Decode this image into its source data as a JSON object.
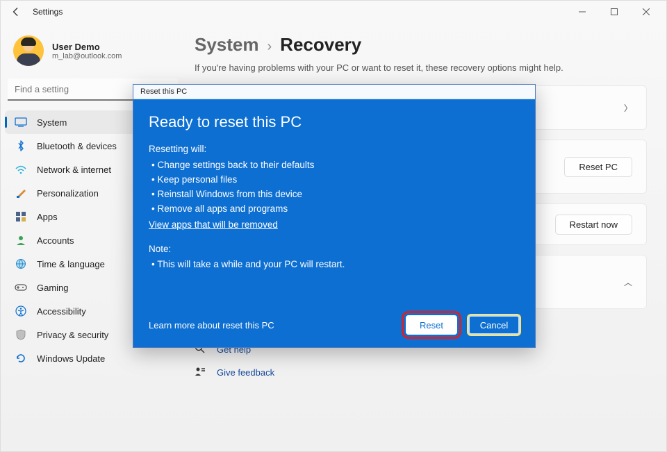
{
  "window": {
    "title": "Settings"
  },
  "profile": {
    "name": "User Demo",
    "email": "m_lab@outlook.com"
  },
  "search_placeholder": "Find a setting",
  "nav": {
    "items": [
      {
        "label": "System",
        "active": true
      },
      {
        "label": "Bluetooth & devices"
      },
      {
        "label": "Network & internet"
      },
      {
        "label": "Personalization"
      },
      {
        "label": "Apps"
      },
      {
        "label": "Accounts"
      },
      {
        "label": "Time & language"
      },
      {
        "label": "Gaming"
      },
      {
        "label": "Accessibility"
      },
      {
        "label": "Privacy & security"
      },
      {
        "label": "Windows Update"
      }
    ]
  },
  "breadcrumb": {
    "parent": "System",
    "sep": "›",
    "current": "Recovery"
  },
  "subtitle": "If you're having problems with your PC or want to reset it, these recovery options might help.",
  "cards": {
    "reset_pc_button": "Reset PC",
    "restart_now_button": "Restart now"
  },
  "footer": {
    "get_help": "Get help",
    "give_feedback": "Give feedback"
  },
  "dialog": {
    "title": "Reset this PC",
    "heading": "Ready to reset this PC",
    "resetting_will_label": "Resetting will:",
    "bullets": [
      "Change settings back to their defaults",
      "Keep personal files",
      "Reinstall Windows from this device",
      "Remove all apps and programs"
    ],
    "view_apps_link": "View apps that will be removed",
    "note_label": "Note:",
    "note_bullet": "This will take a while and your PC will restart.",
    "learn_more": "Learn more about reset this PC",
    "reset_button": "Reset",
    "cancel_button": "Cancel"
  }
}
